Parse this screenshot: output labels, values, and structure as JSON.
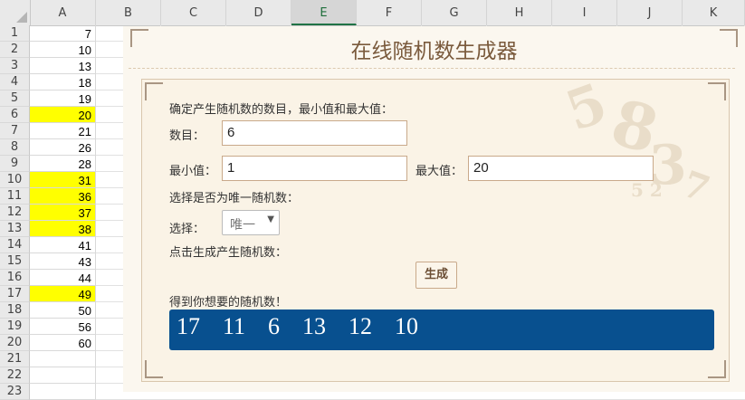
{
  "spreadsheet": {
    "columns": [
      "A",
      "B",
      "C",
      "D",
      "E",
      "F",
      "G",
      "H",
      "I",
      "J",
      "K"
    ],
    "selected_column": "E",
    "rows": [
      {
        "n": "1",
        "a": "7",
        "hl": false
      },
      {
        "n": "2",
        "a": "10",
        "hl": false
      },
      {
        "n": "3",
        "a": "13",
        "hl": false
      },
      {
        "n": "4",
        "a": "18",
        "hl": false
      },
      {
        "n": "5",
        "a": "19",
        "hl": false
      },
      {
        "n": "6",
        "a": "20",
        "hl": true
      },
      {
        "n": "7",
        "a": "21",
        "hl": false
      },
      {
        "n": "8",
        "a": "26",
        "hl": false
      },
      {
        "n": "9",
        "a": "28",
        "hl": false
      },
      {
        "n": "10",
        "a": "31",
        "hl": true
      },
      {
        "n": "11",
        "a": "36",
        "hl": true
      },
      {
        "n": "12",
        "a": "37",
        "hl": true
      },
      {
        "n": "13",
        "a": "38",
        "hl": true
      },
      {
        "n": "14",
        "a": "41",
        "hl": false
      },
      {
        "n": "15",
        "a": "43",
        "hl": false
      },
      {
        "n": "16",
        "a": "44",
        "hl": false
      },
      {
        "n": "17",
        "a": "49",
        "hl": true
      },
      {
        "n": "18",
        "a": "50",
        "hl": false
      },
      {
        "n": "19",
        "a": "56",
        "hl": false
      },
      {
        "n": "20",
        "a": "60",
        "hl": false
      },
      {
        "n": "21",
        "a": "",
        "hl": false
      },
      {
        "n": "22",
        "a": "",
        "hl": false
      },
      {
        "n": "23",
        "a": "",
        "hl": false
      }
    ],
    "highlight_color": "#ffff00"
  },
  "generator": {
    "title": "在线随机数生成器",
    "instruction": "确定产生随机数的数目，最小值和最大值：",
    "count_label": "数目：",
    "count_value": "6",
    "min_label": "最小值：",
    "min_value": "1",
    "max_label": "最大值：",
    "max_value": "20",
    "unique_prompt": "选择是否为唯一随机数：",
    "select_label": "选择：",
    "select_value": "唯一",
    "click_prompt": "点击生成产生随机数：",
    "generate_button": "生成",
    "result_label": "得到你想要的随机数！",
    "result_numbers": "17  11  6  13  12  10",
    "result_bg_color": "#08508f"
  }
}
